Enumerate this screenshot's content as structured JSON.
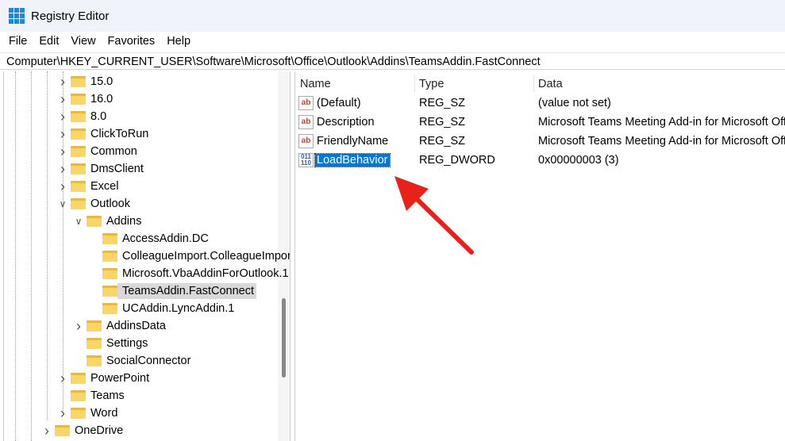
{
  "window": {
    "title": "Registry Editor"
  },
  "menu": [
    "File",
    "Edit",
    "View",
    "Favorites",
    "Help"
  ],
  "address": "Computer\\HKEY_CURRENT_USER\\Software\\Microsoft\\Office\\Outlook\\Addins\\TeamsAddin.FastConnect",
  "tree": [
    {
      "label": "15.0",
      "level": 0,
      "chevron": ">"
    },
    {
      "label": "16.0",
      "level": 0,
      "chevron": ">"
    },
    {
      "label": "8.0",
      "level": 0,
      "chevron": ">"
    },
    {
      "label": "ClickToRun",
      "level": 0,
      "chevron": ">"
    },
    {
      "label": "Common",
      "level": 0,
      "chevron": ">"
    },
    {
      "label": "DmsClient",
      "level": 0,
      "chevron": ">"
    },
    {
      "label": "Excel",
      "level": 0,
      "chevron": ">"
    },
    {
      "label": "Outlook",
      "level": 0,
      "chevron": "v"
    },
    {
      "label": "Addins",
      "level": 1,
      "chevron": "v"
    },
    {
      "label": "AccessAddin.DC",
      "level": 2,
      "chevron": ""
    },
    {
      "label": "ColleagueImport.ColleagueImportAddin",
      "level": 2,
      "chevron": ""
    },
    {
      "label": "Microsoft.VbaAddinForOutlook.1",
      "level": 2,
      "chevron": ""
    },
    {
      "label": "TeamsAddin.FastConnect",
      "level": 2,
      "chevron": "",
      "selected": true
    },
    {
      "label": "UCAddin.LyncAddin.1",
      "level": 2,
      "chevron": ""
    },
    {
      "label": "AddinsData",
      "level": 1,
      "chevron": ">"
    },
    {
      "label": "Settings",
      "level": 1,
      "chevron": ""
    },
    {
      "label": "SocialConnector",
      "level": 1,
      "chevron": ""
    },
    {
      "label": "PowerPoint",
      "level": 0,
      "chevron": ">"
    },
    {
      "label": "Teams",
      "level": 0,
      "chevron": ""
    },
    {
      "label": "Word",
      "level": 0,
      "chevron": ">"
    },
    {
      "label": "OneDrive",
      "level": -1,
      "chevron": ">"
    }
  ],
  "columns": {
    "name": "Name",
    "type": "Type",
    "data": "Data"
  },
  "values": [
    {
      "name": "(Default)",
      "type": "REG_SZ",
      "data": "(value not set)",
      "icon": "ab"
    },
    {
      "name": "Description",
      "type": "REG_SZ",
      "data": "Microsoft Teams Meeting Add-in for Microsoft Office",
      "icon": "ab"
    },
    {
      "name": "FriendlyName",
      "type": "REG_SZ",
      "data": "Microsoft Teams Meeting Add-in for Microsoft Office",
      "icon": "ab"
    },
    {
      "name": "LoadBehavior",
      "type": "REG_DWORD",
      "data": "0x00000003 (3)",
      "icon": "bin",
      "selected": true
    }
  ],
  "annotation_color": "#e8211b"
}
